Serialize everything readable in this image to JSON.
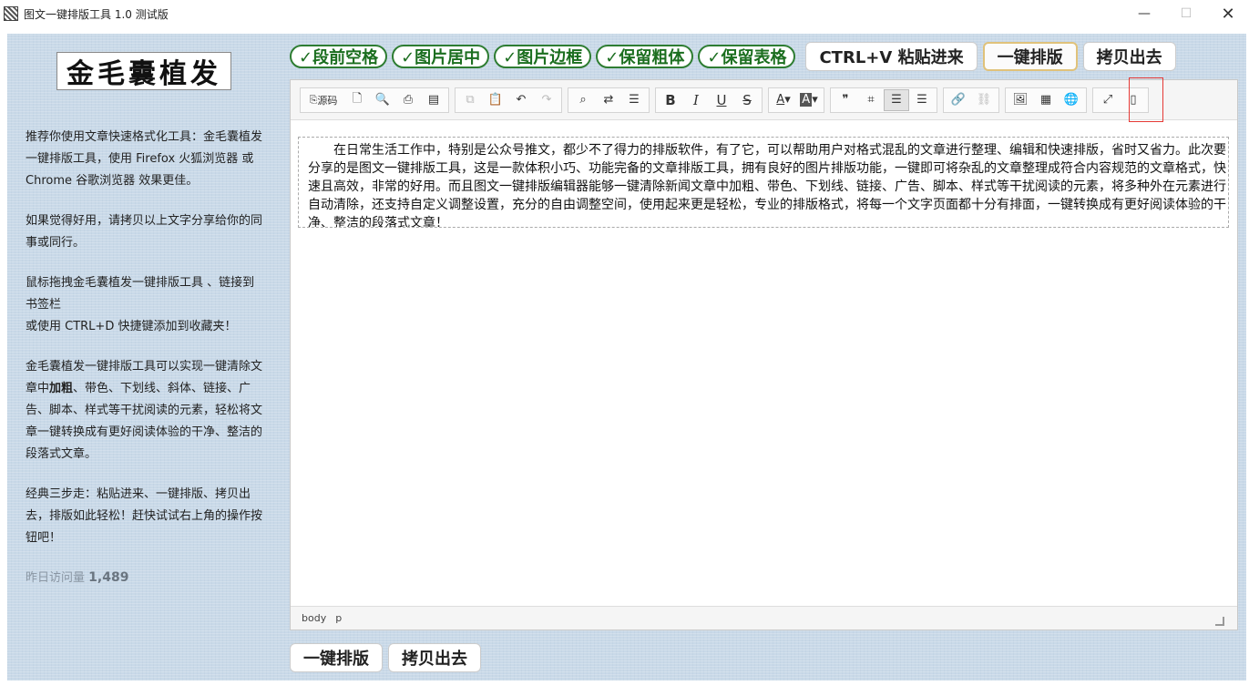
{
  "window": {
    "title": "图文一键排版工具 1.0 测试版",
    "minimize": "—",
    "maximize": "☐",
    "close": "✕"
  },
  "sidebar": {
    "logo_text": "金毛囊植发",
    "p1": "推荐你使用文章快速格式化工具：金毛囊植发一键排版工具，使用 Firefox 火狐浏览器 或 Chrome 谷歌浏览器 效果更佳。",
    "p2": "如果觉得好用，请拷贝以上文字分享给你的同事或同行。",
    "p3a": "鼠标拖拽金毛囊植发一键排版工具 、链接到书签栏",
    "p3b": "或使用 CTRL+D 快捷键添加到收藏夹！",
    "p4a": "金毛囊植发一键排版工具可以实现一键清除文章中",
    "p4bold": "加粗",
    "p4b": "、带色、下划线、斜体、链接、广告、脚本、样式等干扰阅读的元素，轻松将文章一键转换成有更好阅读体验的干净、整洁的段落式文章。",
    "p5": "经典三步走：粘贴进来、一键排版、拷贝出去，排版如此轻松！赶快试试右上角的操作按钮吧！",
    "visits_label": "昨日访问量",
    "visits_value": "1,489"
  },
  "options": [
    {
      "label": "✓段前空格"
    },
    {
      "label": "✓图片居中"
    },
    {
      "label": "✓图片边框"
    },
    {
      "label": "✓保留粗体"
    },
    {
      "label": "✓保留表格"
    }
  ],
  "actions": {
    "paste": "CTRL+V 粘贴进来",
    "format": "一键排版",
    "copy": "拷贝出去"
  },
  "toolbar": {
    "source_label": "源码",
    "bold": "B",
    "italic": "I",
    "underline": "U",
    "strike": "S",
    "fontcolor": "A",
    "bgcolor": "A"
  },
  "editor": {
    "content": "在日常生活工作中，特别是公众号推文，都少不了得力的排版软件，有了它，可以帮助用户对格式混乱的文章进行整理、编辑和快速排版，省时又省力。此次要分享的是图文一键排版工具，这是一款体积小巧、功能完备的文章排版工具，拥有良好的图片排版功能，一键即可将杂乱的文章整理成符合内容规范的文章格式，快速且高效，非常的好用。而且图文一键排版编辑器能够一键清除新闻文章中加粗、带色、下划线、链接、广告、脚本、样式等干扰阅读的元素，将多种外在元素进行自动清除，还支持自定义调整设置，充分的自由调整空间，使用起来更是轻松，专业的排版格式，将每一个文字页面都十分有排面，一键转换成有更好阅读体验的干净、整洁的段落式文章！",
    "path": [
      "body",
      "p"
    ]
  },
  "bottom": {
    "format": "一键排版",
    "copy": "拷贝出去"
  }
}
